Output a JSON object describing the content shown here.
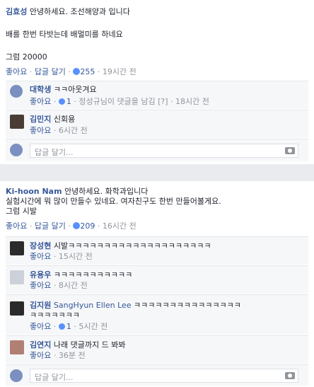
{
  "post1": {
    "author": "김효성",
    "line1": "안녕하세요. 조선해양과 입니다",
    "line2": "배를 한번 타밧는데 배멀미를 하네요",
    "line3": "그럼 20000",
    "like_label": "좋아요",
    "reply_label": "답글 달기",
    "like_count": "255",
    "time": "19시간 전",
    "replies": [
      {
        "author": "대학생",
        "text": "ㅋㅋ아웃겨요",
        "like_label": "좋아요",
        "like_count": "1",
        "extra": "정성규님이 댓글을 남김",
        "time": "18시간 전"
      },
      {
        "author": "김민지",
        "text": "신회용",
        "like_label": "좋아요",
        "time": "6시간 전"
      }
    ],
    "reply_placeholder": "답글 달기..."
  },
  "post2": {
    "author": "Ki-hoon Nam",
    "line1": "안녕하세요. 화학과입니다",
    "line2": "실험시간에 뭐 많이 만들수 있네요. 여자친구도 한번 만들어볼게요.",
    "line3": "그럼 시발",
    "like_label": "좋아요",
    "reply_label": "답글 달기",
    "like_count": "209",
    "time": "16시간 전",
    "replies": [
      {
        "author": "장성현",
        "text": "시발ㅋㅋㅋㅋㅋㅋㅋㅋㅋㅋㅋㅋㅋㅋㅋㅋㅋㅋㅋㅋ",
        "like_label": "좋아요",
        "time": "15시간 전"
      },
      {
        "author": "유용우",
        "text": "ㅋㅋㅋㅋㅋㅋㅋㅋㅋㅋㅋ",
        "like_label": "좋아요",
        "time": "8시간 전"
      },
      {
        "author": "김지원",
        "mention": "SangHyun Ellen Lee",
        "text": "ㅋㅋㅋㅋㅋㅋㅋㅋㅋㅋㅋㅋㅋㅋㅋ",
        "text2": "ㅋㅋㅋㅋㅋㅋㅋ",
        "like_label": "좋아요",
        "like_count": "1",
        "time": "5시간 전"
      },
      {
        "author": "김연지",
        "text": "나래 댓글까지 드 봐봐",
        "like_label": "좋아요",
        "time": "36분 전"
      }
    ],
    "reply_placeholder": "답글 달기..."
  }
}
